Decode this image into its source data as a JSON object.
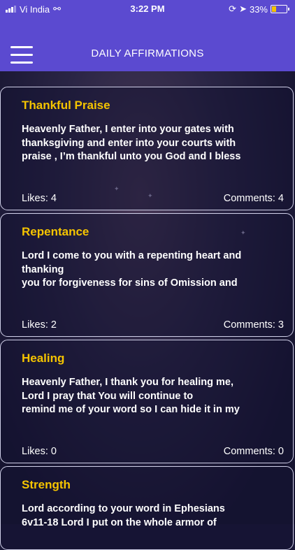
{
  "status_bar": {
    "carrier": "Vi India",
    "time": "3:22 PM",
    "battery": "33%"
  },
  "header": {
    "title": "DAILY AFFIRMATIONS",
    "menu_icon": "hamburger-menu-icon"
  },
  "cards": [
    {
      "title": "Thankful Praise",
      "body": "Heavenly Father, I enter into your gates with\nthanksgiving and enter into your courts with\npraise , I’m thankful unto you God and I bless",
      "likes": "Likes: 4",
      "comments": "Comments: 4"
    },
    {
      "title": "Repentance",
      "body": "Lord I come to you with a repenting heart and\nthanking\nyou for forgiveness for sins of Omission and",
      "likes": "Likes: 2",
      "comments": "Comments: 3"
    },
    {
      "title": "Healing",
      "body": "Heavenly Father, I thank you for healing me,\nLord I pray that You will continue to\nremind me of your word so I can hide it in my",
      "likes": "Likes: 0",
      "comments": "Comments: 0"
    },
    {
      "title": "Strength",
      "body": "Lord according to your word in Ephesians\n6v11-18 Lord I put on the whole armor of",
      "likes": "",
      "comments": ""
    }
  ],
  "colors": {
    "header": "#5b4ad0",
    "title_accent": "#f5c400"
  }
}
